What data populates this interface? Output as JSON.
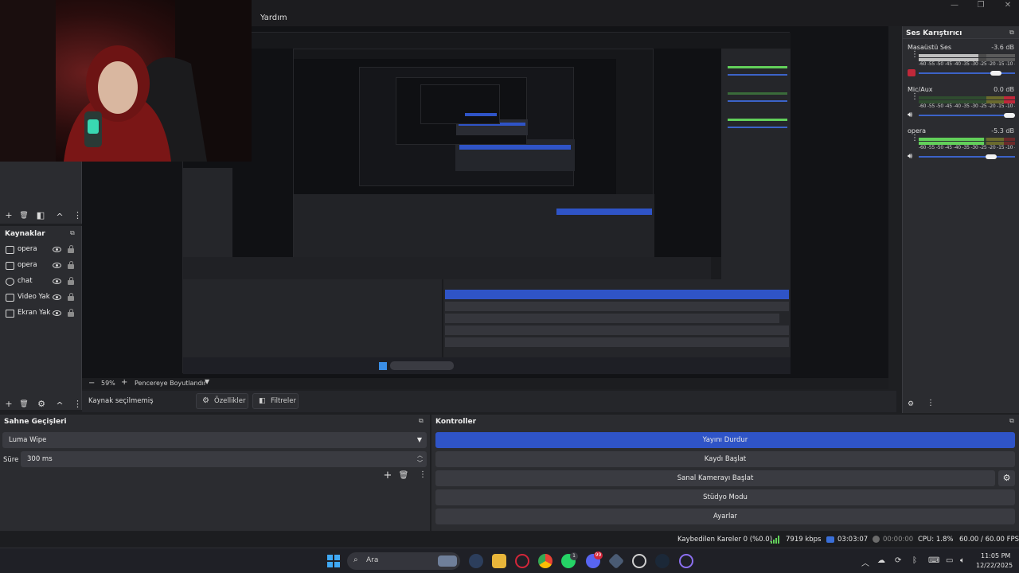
{
  "menubar": {
    "help_label": "Yardım",
    "min": "—",
    "restore": "❐",
    "close": "✕"
  },
  "scenes": {
    "add": "+",
    "remove": "🗑",
    "filter": "◧",
    "up": "^",
    "more": "⋮"
  },
  "sources": {
    "title": "Kaynaklar",
    "items": [
      {
        "label": "opera",
        "icon": "window-icon"
      },
      {
        "label": "opera",
        "icon": "window-icon"
      },
      {
        "label": "chat",
        "icon": "browser-icon"
      },
      {
        "label": "Video Yak",
        "icon": "camera-icon"
      },
      {
        "label": "Ekran Yak",
        "icon": "monitor-icon"
      }
    ],
    "add": "+",
    "remove": "🗑",
    "settings": "⚙",
    "up": "^",
    "more": "⋮"
  },
  "zoom": {
    "minus": "−",
    "value": "59%",
    "plus": "+",
    "fit_label": "Pencereye Boyutlandır"
  },
  "props": {
    "no_source": "Kaynak seçilmemiş",
    "properties_label": "Özellikler",
    "filters_label": "Filtreler"
  },
  "mixer": {
    "title": "Ses Karıştırıcı",
    "scale": "-60 -55 -50 -45 -40 -35 -30 -25 -20 -15 -10 -5 0",
    "channels": [
      {
        "name": "Masaüstü Ses",
        "db": "-3.6 dB",
        "level": 0.62,
        "muted": true
      },
      {
        "name": "Mic/Aux",
        "db": "0.0 dB",
        "level": 0.0,
        "muted": false
      },
      {
        "name": "opera",
        "db": "-5.3 dB",
        "level": 0.68,
        "muted": false
      }
    ]
  },
  "transitions": {
    "title": "Sahne Geçişleri",
    "type_value": "Luma Wipe",
    "duration_label": "Süre",
    "duration_value": "300 ms"
  },
  "controls": {
    "title": "Kontroller",
    "buttons": [
      "Yayını Durdur",
      "Kaydı Başlat",
      "Sanal Kamerayı Başlat",
      "Stüdyo Modu",
      "Ayarlar"
    ]
  },
  "status": {
    "dropped": "Kaybedilen Kareler 0 (%0.0)",
    "bitrate": "7919 kbps",
    "stream_time": "03:03:07",
    "rec_time": "00:00:00",
    "cpu": "CPU: 1.8%",
    "fps": "60.00 / 60.00 FPS"
  },
  "taskbar": {
    "search_placeholder": "Ara",
    "time": "11:05 PM",
    "date": "12/22/2025",
    "badge_whatsapp": "1",
    "badge_discord": "99"
  },
  "colors": {
    "accent": "#2f54c7",
    "meter_green": "#62d05a",
    "meter_yellow": "#6a6a2d",
    "meter_red": "#6b2a2a"
  }
}
